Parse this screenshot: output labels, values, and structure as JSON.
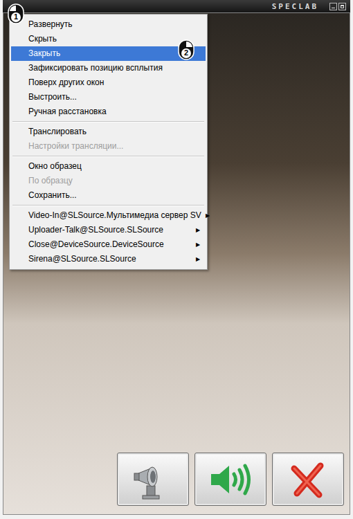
{
  "window": {
    "logo": "SPECLAB"
  },
  "context_menu": {
    "items": [
      {
        "kind": "item",
        "label": "Развернуть",
        "selected": false,
        "disabled": false
      },
      {
        "kind": "item",
        "label": "Скрыть",
        "selected": false,
        "disabled": false
      },
      {
        "kind": "item",
        "label": "Закрыть",
        "selected": true,
        "disabled": false
      },
      {
        "kind": "item",
        "label": "Зафиксировать позицию всплытия",
        "selected": false,
        "disabled": false
      },
      {
        "kind": "item",
        "label": "Поверх других окон",
        "selected": false,
        "disabled": false
      },
      {
        "kind": "item",
        "label": "Выстроить...",
        "selected": false,
        "disabled": false
      },
      {
        "kind": "item",
        "label": "Ручная расстановка",
        "selected": false,
        "disabled": false
      },
      {
        "kind": "separator"
      },
      {
        "kind": "item",
        "label": "Транслировать",
        "selected": false,
        "disabled": false
      },
      {
        "kind": "item",
        "label": "Настройки трансляции...",
        "selected": false,
        "disabled": true
      },
      {
        "kind": "separator"
      },
      {
        "kind": "item",
        "label": "Окно образец",
        "selected": false,
        "disabled": false
      },
      {
        "kind": "item",
        "label": "По образцу",
        "selected": false,
        "disabled": true
      },
      {
        "kind": "item",
        "label": "Сохранить...",
        "selected": false,
        "disabled": false
      },
      {
        "kind": "separator"
      },
      {
        "kind": "submenu",
        "label": "Video-In@SLSource.Мультимедиа сервер SV",
        "arrow": "▶",
        "selected": false,
        "disabled": false
      },
      {
        "kind": "submenu",
        "label": "Uploader-Talk@SLSource.SLSource",
        "arrow": "▶",
        "selected": false,
        "disabled": false
      },
      {
        "kind": "submenu",
        "label": "Close@DeviceSource.DeviceSource",
        "arrow": "▶",
        "selected": false,
        "disabled": false
      },
      {
        "kind": "submenu",
        "label": "Sirena@SLSource.SLSource",
        "arrow": "▶",
        "selected": false,
        "disabled": false
      }
    ]
  },
  "annotations": [
    {
      "label": "1"
    },
    {
      "label": "2"
    }
  ]
}
